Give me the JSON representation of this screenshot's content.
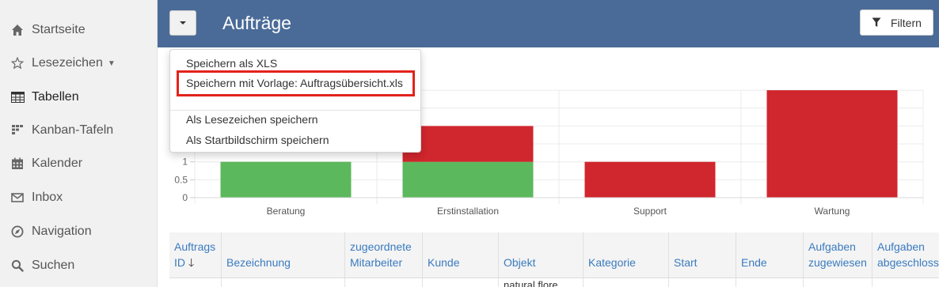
{
  "sidebar": {
    "items": [
      {
        "label": "Startseite",
        "icon": "home-icon"
      },
      {
        "label": "Lesezeichen",
        "icon": "star-icon",
        "has_caret": true
      },
      {
        "label": "Tabellen",
        "icon": "table-icon",
        "active": true
      },
      {
        "label": "Kanban-Tafeln",
        "icon": "kanban-icon"
      },
      {
        "label": "Kalender",
        "icon": "calendar-icon"
      },
      {
        "label": "Inbox",
        "icon": "envelope-icon"
      },
      {
        "label": "Navigation",
        "icon": "compass-icon"
      },
      {
        "label": "Suchen",
        "icon": "search-icon"
      }
    ]
  },
  "header": {
    "title": "Aufträge",
    "filter_label": "Filtern",
    "background": "#4a6b97"
  },
  "dropdown": {
    "items": [
      "Speichern als XLS",
      "Speichern mit Vorlage: Auftragsübersicht.xls",
      "Als Lesezeichen speichern",
      "Als Startbildschirm speichern"
    ],
    "highlighted_index": 1,
    "highlight_color": "#e3221b"
  },
  "chart_data": {
    "type": "bar",
    "stacked": true,
    "categories": [
      "Beratung",
      "Erstinstallation",
      "Support",
      "Wartung"
    ],
    "series": [
      {
        "color": "#5cb85c",
        "values": [
          1,
          1,
          0,
          0
        ]
      },
      {
        "color": "#d0262d",
        "values": [
          0,
          1,
          1,
          3
        ]
      }
    ],
    "y_ticks": [
      {
        "value": 1,
        "label": "1"
      },
      {
        "value": 0.5,
        "label": "0.5"
      },
      {
        "value": 0,
        "label": "0"
      }
    ],
    "ylim": [
      0,
      3
    ],
    "grid": true
  },
  "table": {
    "columns": [
      [
        "Auftrags",
        "ID"
      ],
      [
        "",
        "Bezeichnung"
      ],
      [
        "zugeordnete",
        "Mitarbeiter"
      ],
      [
        "",
        "Kunde"
      ],
      [
        "",
        "Objekt"
      ],
      [
        "",
        "Kategorie"
      ],
      [
        "",
        "Start"
      ],
      [
        "",
        "Ende"
      ],
      [
        "Aufgaben",
        "zugewiesen"
      ],
      [
        "Aufgaben",
        "abgeschlossen"
      ]
    ],
    "sort_indicator": "🡓",
    "rows": [
      {
        "objekt": "natural flore"
      }
    ]
  }
}
